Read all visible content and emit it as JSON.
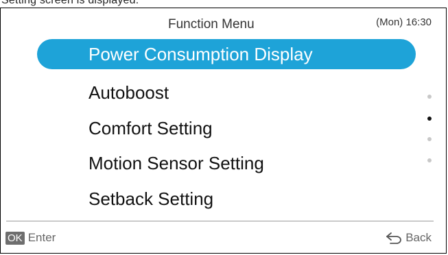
{
  "caption": "Setting screen is displayed.",
  "header": {
    "title": "Function Menu",
    "datetime": "(Mon) 16:30"
  },
  "menu": {
    "items": [
      {
        "label": "Power Consumption Display",
        "selected": true
      },
      {
        "label": "Autoboost",
        "selected": false
      },
      {
        "label": "Comfort Setting",
        "selected": false
      },
      {
        "label": "Motion Sensor Setting",
        "selected": false
      },
      {
        "label": "Setback Setting",
        "selected": false
      }
    ]
  },
  "pagination": {
    "page_count": 4,
    "current_page": 2
  },
  "footer": {
    "ok_badge": "OK",
    "enter_label": "Enter",
    "back_label": "Back",
    "back_icon": "back-arrow-icon"
  },
  "colors": {
    "accent": "#1ea3d8",
    "text": "#111111",
    "muted": "#666666",
    "dot_inactive": "#c8c8c8",
    "dot_active": "#111111"
  }
}
